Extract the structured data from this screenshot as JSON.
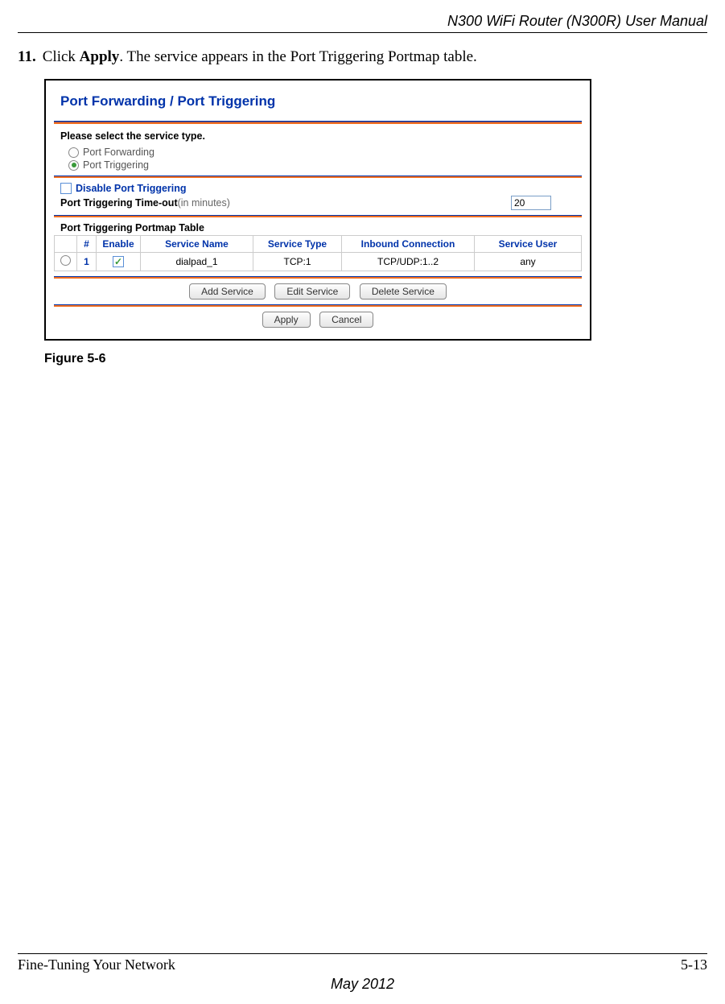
{
  "header": {
    "doc_title": "N300 WiFi Router (N300R) User Manual"
  },
  "step": {
    "number": "11.",
    "pre": "Click ",
    "bold": "Apply",
    "post": ". The service appears in the Port Triggering Portmap table."
  },
  "app": {
    "title": "Port Forwarding / Port Triggering",
    "select_prompt": "Please select the service type.",
    "radio1": "Port Forwarding",
    "radio2": "Port Triggering",
    "disable_checkbox": "Disable Port Triggering",
    "timeout_label": "Port Triggering Time-out",
    "timeout_hint": "(in minutes)",
    "timeout_value": "20",
    "portmap_title": "Port Triggering Portmap Table",
    "table": {
      "headers": {
        "sel": "",
        "num": "#",
        "enable": "Enable",
        "service_name": "Service Name",
        "service_type": "Service Type",
        "inbound": "Inbound Connection",
        "user": "Service User"
      },
      "row": {
        "num": "1",
        "service_name": "dialpad_1",
        "service_type": "TCP:1",
        "inbound": "TCP/UDP:1..2",
        "user": "any"
      }
    },
    "buttons": {
      "add": "Add Service",
      "edit": "Edit Service",
      "delete": "Delete Service",
      "apply": "Apply",
      "cancel": "Cancel"
    }
  },
  "figure_caption": "Figure 5-6",
  "footer": {
    "left": "Fine-Tuning Your Network",
    "right": "5-13",
    "center": "May 2012"
  }
}
